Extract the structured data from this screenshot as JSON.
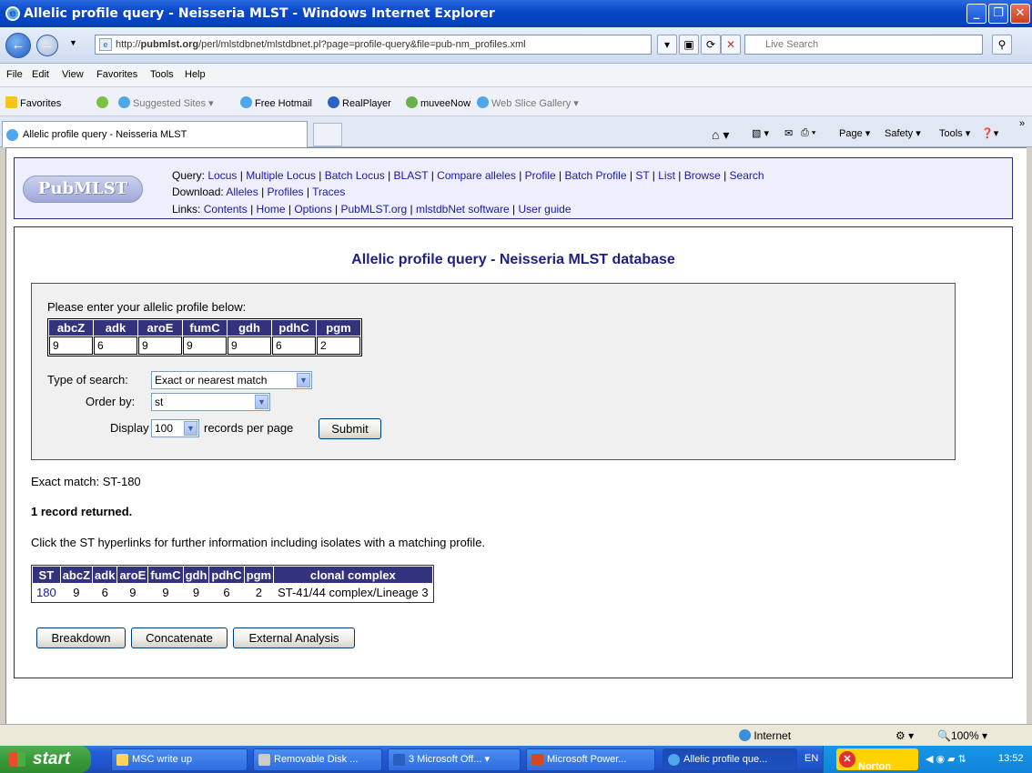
{
  "window": {
    "title": "Allelic profile query - Neisseria MLST - Windows Internet Explorer"
  },
  "browser": {
    "url_prefix": "http://",
    "url_host": "pubmlst.org",
    "url_path": "/perl/mlstdbnet/mlstdbnet.pl?page=profile-query&file=pub-nm_profiles.xml",
    "search_placeholder": "Live Search",
    "menu": [
      "File",
      "Edit",
      "View",
      "Favorites",
      "Tools",
      "Help"
    ],
    "favorites": {
      "label": "Favorites",
      "items": [
        "Suggested Sites ▾",
        "Free Hotmail",
        "RealPlayer",
        "muveeNow",
        "Web Slice Gallery ▾"
      ]
    },
    "tab_title": "Allelic profile query - Neisseria MLST",
    "commands": [
      "Page ▾",
      "Safety ▾",
      "Tools ▾"
    ]
  },
  "site": {
    "logo": "PubMLST",
    "query_label": "Query:",
    "query_links": [
      "Locus",
      "Multiple Locus",
      "Batch Locus",
      "BLAST",
      "Compare alleles",
      "Profile",
      "Batch Profile",
      "ST",
      "List",
      "Browse",
      "Search"
    ],
    "download_label": "Download:",
    "download_links": [
      "Alleles",
      "Profiles",
      "Traces"
    ],
    "links_label": "Links:",
    "links_links": [
      "Contents",
      "Home",
      "Options",
      "PubMLST.org",
      "mlstdbNet software",
      "User guide"
    ]
  },
  "page": {
    "title": "Allelic profile query - Neisseria MLST database",
    "prompt": "Please enter your allelic profile below:",
    "loci": [
      "abcZ",
      "adk",
      "aroE",
      "fumC",
      "gdh",
      "pdhC",
      "pgm"
    ],
    "profile_values": [
      "9",
      "6",
      "9",
      "9",
      "9",
      "6",
      "2"
    ],
    "search_type_label": "Type of search:",
    "search_type_value": "Exact or nearest match",
    "order_label": "Order by:",
    "order_value": "st",
    "display_label": "Display",
    "display_value": "100",
    "per_page_label": "records per page",
    "submit_label": "Submit",
    "exact_match": "Exact match: ST-180",
    "records_returned": "1 record returned.",
    "hint": "Click the ST hyperlinks for further information including isolates with a matching profile.",
    "results_headers": [
      "ST",
      "abcZ",
      "adk",
      "aroE",
      "fumC",
      "gdh",
      "pdhC",
      "pgm",
      "clonal complex"
    ],
    "results_rows": [
      [
        "180",
        "9",
        "6",
        "9",
        "9",
        "9",
        "6",
        "2",
        "ST-41/44 complex/Lineage 3"
      ]
    ],
    "actions": [
      "Breakdown",
      "Concatenate",
      "External Analysis"
    ]
  },
  "status": {
    "zone": "Internet",
    "zoom": "100%"
  },
  "taskbar": {
    "start": "start",
    "tasks": [
      "MSC write up",
      "Removable Disk ...",
      "3 Microsoft Off...",
      "Microsoft Power...",
      "Allelic profile que..."
    ],
    "lang": "EN",
    "norton": "Norton",
    "clock": "13:52"
  }
}
